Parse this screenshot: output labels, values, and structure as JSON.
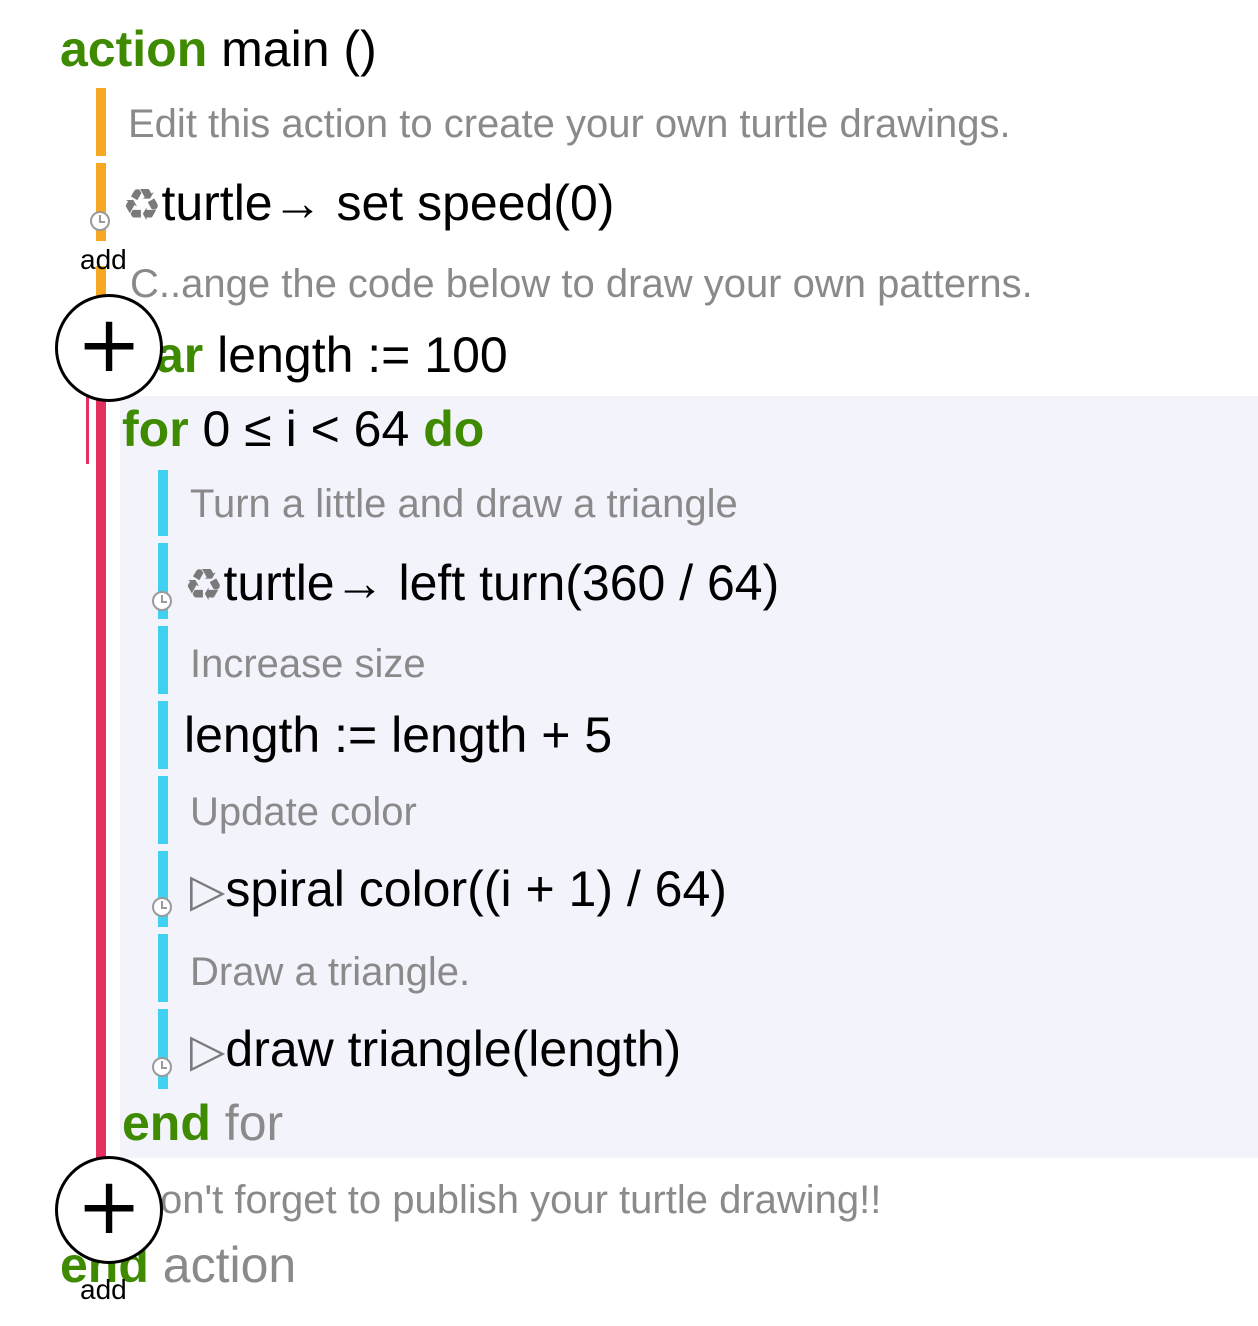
{
  "header": {
    "keyword": "action",
    "signature": "main ()"
  },
  "lines": {
    "comment_edit": "Edit this action to create your own turtle drawings.",
    "recycle_icon": "♻",
    "turtle_speed": "turtle→ set speed(0)",
    "comment_change": "C..ange the code below to draw your own patterns.",
    "var_kw": "ar",
    "var_rest": " length := 100",
    "for_kw": "for",
    "for_rest": " 0 ≤ i < 64 ",
    "do_kw": "do",
    "comment_turn": "Turn a little and draw a triangle",
    "turtle_turn": "turtle→ left turn(360 / 64)",
    "comment_increase": "Increase size",
    "length_update": "length := length + 5",
    "comment_color": "Update color",
    "triangle_icon": "▷",
    "spiral_color": "spiral color((i + 1) / 64)",
    "comment_draw": "Draw a triangle.",
    "draw_triangle": "draw triangle(length)",
    "end_kw": "end",
    "end_for_rest": " for",
    "comment_publish": "on't forget to publish your turtle drawing!!",
    "end_action_kw": "end",
    "end_action_rest": " action"
  },
  "add_buttons": {
    "plus": "+",
    "label": "add"
  },
  "colors": {
    "keyword": "#3e8a00",
    "comment": "#8a8a8a",
    "action_bar": "#f7a823",
    "loop_bar": "#e3305e",
    "body_bar": "#3fd0f2",
    "loop_bg": "#f2f3fb"
  }
}
